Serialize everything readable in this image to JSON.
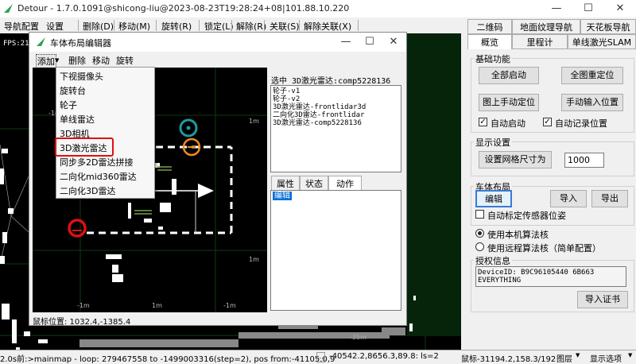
{
  "window": {
    "title": "Detour - 1.7.0.1091@shicong-liu@2023-08-23T19:28:24+08|101.88.10.220"
  },
  "menubar": [
    "导航配置",
    "设置",
    "删除(D)",
    "移动(M)",
    "旋转(R)",
    "锁定(L)",
    "解除(R)",
    "关联(S)",
    "解除关联(X)"
  ],
  "map": {
    "fps": "FPS:21",
    "labels": [
      "1m",
      "1m",
      "-1m",
      "1m",
      "-1m",
      "-1m",
      "-35m"
    ],
    "colors": {
      "bg": "#000000",
      "grid": "#0f3a12",
      "path": "#ffffff",
      "cyan": "#1f9aa0",
      "orange": "#f08a1e",
      "red": "#e01010"
    }
  },
  "subwindow": {
    "title": "车体布局编辑器",
    "menu": [
      "添加",
      "删除",
      "移动",
      "旋转"
    ],
    "selected_label": "选中 3D激光雷达:comp5228136",
    "components": [
      "轮子-v1",
      "轮子-v2",
      "3D激光雷达-frontlidar3d",
      "二向化3D雷达-frontlidar",
      "3D激光雷达-comp5228136"
    ],
    "tabs": [
      "属性",
      "状态",
      "动作"
    ],
    "action_item": "编辑",
    "mouse_pos": "鼠标位置: 1032.4,-1385.4"
  },
  "add_menu": {
    "items": [
      "下视摄像头",
      "旋转台",
      "轮子",
      "单线雷达",
      "3D相机",
      "3D激光雷达",
      "同步多2D雷达拼接",
      "二向化mid360雷达",
      "二向化3D雷达"
    ],
    "highlighted": "3D激光雷达"
  },
  "right_panel": {
    "tabs_row1": [
      "二维码",
      "地面纹理导航",
      "天花板导航"
    ],
    "tabs_row2": [
      "概览",
      "里程计",
      "单线激光SLAM"
    ],
    "basic": {
      "title": "基础功能",
      "buttons": [
        "全部启动",
        "全图重定位",
        "图上手动定位",
        "手动输入位置"
      ],
      "checks": [
        "自动启动",
        "自动记录位置"
      ]
    },
    "display": {
      "title": "显示设置",
      "button": "设置网格尺寸为",
      "value": "1000"
    },
    "layout": {
      "title": "车体布局",
      "buttons": [
        "编辑",
        "导入",
        "导出"
      ],
      "check": "自动标定传感器位姿"
    },
    "algo": {
      "options": [
        "使用本机算法核",
        "使用远程算法核（简单配置）"
      ]
    },
    "license": {
      "title": "授权信息",
      "device": "DeviceID: B9C96105440 6B663",
      "text": "EVERYTHING",
      "button": "导入证书"
    }
  },
  "status": {
    "log": "2.0s前:>mainmap - loop: 279467558 to -1499003316(step=2), pos from:-41105.0,9",
    "pos": "-40542.2,8656.3,89.8: ls=2",
    "cursor": "鼠标-31194.2,158.3/192",
    "layer": "图层",
    "options": "显示选项"
  }
}
